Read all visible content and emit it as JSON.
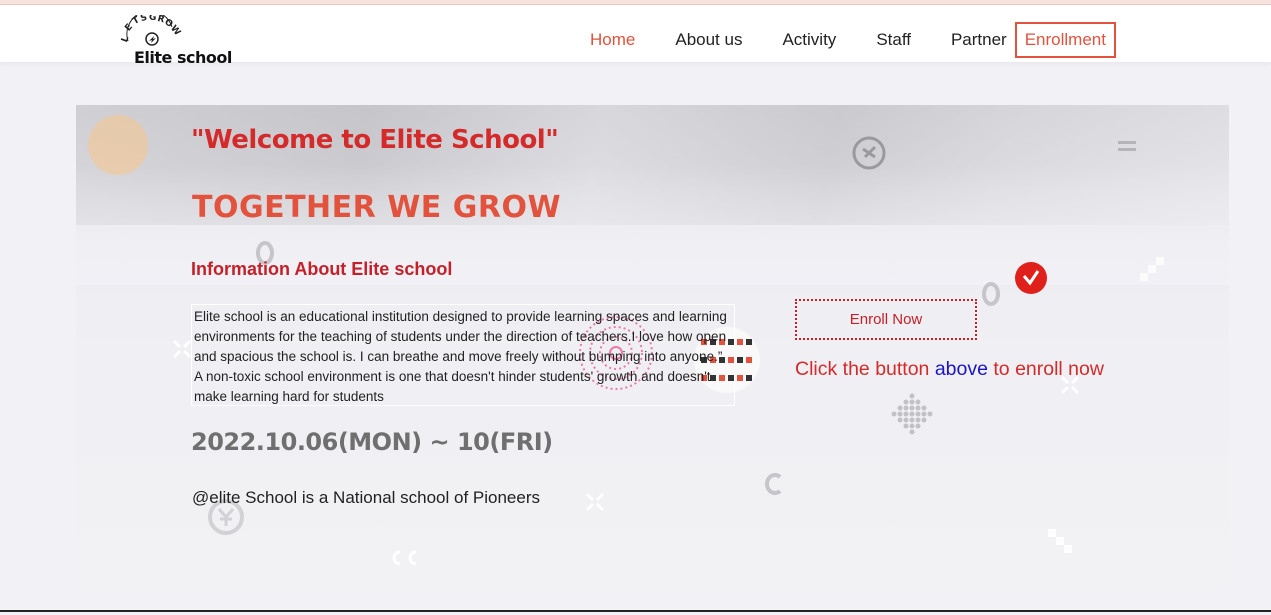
{
  "brand": {
    "logo_tagline": "LETS GROW",
    "name": "Elite school"
  },
  "nav": {
    "items": [
      {
        "label": "Home",
        "active": true
      },
      {
        "label": "About us",
        "active": false
      },
      {
        "label": "Activity",
        "active": false
      },
      {
        "label": "Staff",
        "active": false
      },
      {
        "label": "Partner",
        "active": false
      }
    ],
    "enroll_label": "Enrollment"
  },
  "hero": {
    "welcome": "\"Welcome to Elite School\"",
    "headline": "TOGETHER WE GROW",
    "info_title": "Information About Elite school",
    "info_body": "Elite school is an educational institution designed to provide learning spaces and learning environments for the teaching of students under the direction of teachers.I love how open and spacious the school is. I can breathe and move freely without bumping into anyone.” A non-toxic school environment is one that doesn't hinder students' growth and doesn't make learning hard for students",
    "dates": "2022.10.06(MON) ~ 10(FRI)",
    "tagline": "@elite School is a National school of Pioneers"
  },
  "enroll": {
    "button_label": "Enroll Now",
    "prompt_before": "Click the button ",
    "prompt_highlight": "above",
    "prompt_after": " to enroll now"
  },
  "colors": {
    "accent": "#e2523d",
    "brand_red": "#c5202a",
    "link_blue": "#1a14c8"
  }
}
